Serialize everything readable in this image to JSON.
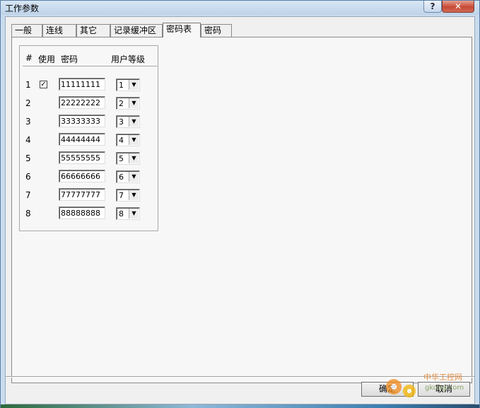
{
  "window": {
    "title": "工作参数",
    "help_label": "?",
    "close_label": "✕"
  },
  "tabs": [
    {
      "label": "一般",
      "active": false
    },
    {
      "label": "连线",
      "active": false
    },
    {
      "label": "其它",
      "active": false
    },
    {
      "label": "记录缓冲区",
      "active": false
    },
    {
      "label": "密码表",
      "active": true
    },
    {
      "label": "密码",
      "active": false
    }
  ],
  "password_table": {
    "headers": {
      "index": "#",
      "use": "使用",
      "password": "密码",
      "level": "用户等级"
    },
    "rows": [
      {
        "index": "1",
        "used": true,
        "password": "11111111",
        "level": "1"
      },
      {
        "index": "2",
        "used": false,
        "password": "22222222",
        "level": "2"
      },
      {
        "index": "3",
        "used": false,
        "password": "33333333",
        "level": "3"
      },
      {
        "index": "4",
        "used": false,
        "password": "44444444",
        "level": "4"
      },
      {
        "index": "5",
        "used": false,
        "password": "55555555",
        "level": "5"
      },
      {
        "index": "6",
        "used": false,
        "password": "66666666",
        "level": "6"
      },
      {
        "index": "7",
        "used": false,
        "password": "77777777",
        "level": "7"
      },
      {
        "index": "8",
        "used": false,
        "password": "88888888",
        "level": "8"
      }
    ]
  },
  "buttons": {
    "ok": "确定",
    "cancel": "取消"
  },
  "watermark": {
    "text": "中华工控网",
    "sub": "gkong.com"
  },
  "icons": {
    "dropdown": "chevron-down-icon",
    "check": "check-icon"
  }
}
